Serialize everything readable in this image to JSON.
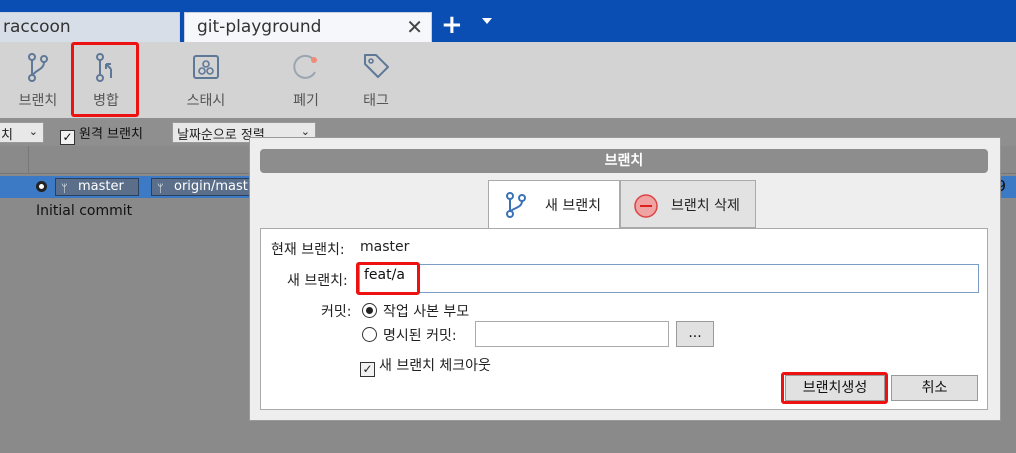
{
  "tabs": [
    {
      "label": "raccoon"
    },
    {
      "label": "git-playground",
      "close": "✕"
    }
  ],
  "tab_add": "+",
  "toolbar": {
    "items": [
      {
        "label": "브랜치",
        "icon": "branch-icon"
      },
      {
        "label": "병합",
        "icon": "merge-icon"
      },
      {
        "label": "스태시",
        "icon": "stash-icon"
      },
      {
        "label": "폐기",
        "icon": "discard-icon"
      },
      {
        "label": "태그",
        "icon": "tag-icon"
      }
    ]
  },
  "filter": {
    "branch_combo": "치",
    "remote_check_label": "원격 브랜치",
    "sort_combo": "날짜순으로 정렬"
  },
  "commits": [
    {
      "refs": [
        "master",
        "origin/mast"
      ],
      "end_text": "9"
    },
    {
      "message": "Initial commit"
    }
  ],
  "dialog": {
    "title": "브랜치",
    "tabs": [
      {
        "label": "새 브랜치"
      },
      {
        "label": "브랜치 삭제"
      }
    ],
    "current_branch_label": "현재 브랜치:",
    "current_branch_value": "master",
    "new_branch_label": "새 브랜치:",
    "new_branch_value": "feat/a",
    "commit_label": "커밋:",
    "commit_options": [
      {
        "label": "작업 사본 부모",
        "selected": true
      },
      {
        "label": "명시된 커밋:",
        "selected": false
      }
    ],
    "specified_commit_value": "",
    "browse_button": "...",
    "checkout_label": "새 브랜치 체크아웃",
    "checkout_checked": true,
    "create_button": "브랜치생성",
    "cancel_button": "취소"
  },
  "colors": {
    "tabbar": "#0a4db3",
    "selection": "#3c7ac6",
    "highlight": "#e11111"
  }
}
